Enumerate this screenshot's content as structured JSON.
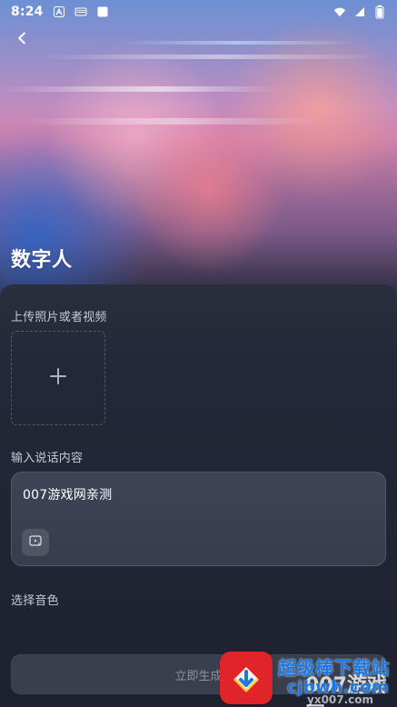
{
  "status_bar": {
    "time": "8:24",
    "icons": [
      "notification-a-icon",
      "keyboard-icon",
      "square-icon",
      "wifi-icon",
      "signal-icon",
      "battery-icon"
    ]
  },
  "header": {
    "title": "数字人"
  },
  "upload": {
    "label": "上传照片或者视频",
    "icon": "plus-icon"
  },
  "speech": {
    "label": "输入说话内容",
    "value": "007游戏网亲测",
    "icon": "video-audio-icon"
  },
  "voice": {
    "label": "选择音色"
  },
  "action": {
    "generate_label": "立即生成"
  },
  "watermark": {
    "brand": "超级棒下载站",
    "url": "cjbwh.com",
    "sub": "007游戏网",
    "bottom": "yx007.com"
  },
  "colors": {
    "panel": "#232838",
    "card": "#3b4152",
    "button": "#3a3f4d",
    "brand_blue": "#1878e6",
    "brand_red": "#e0242a"
  }
}
